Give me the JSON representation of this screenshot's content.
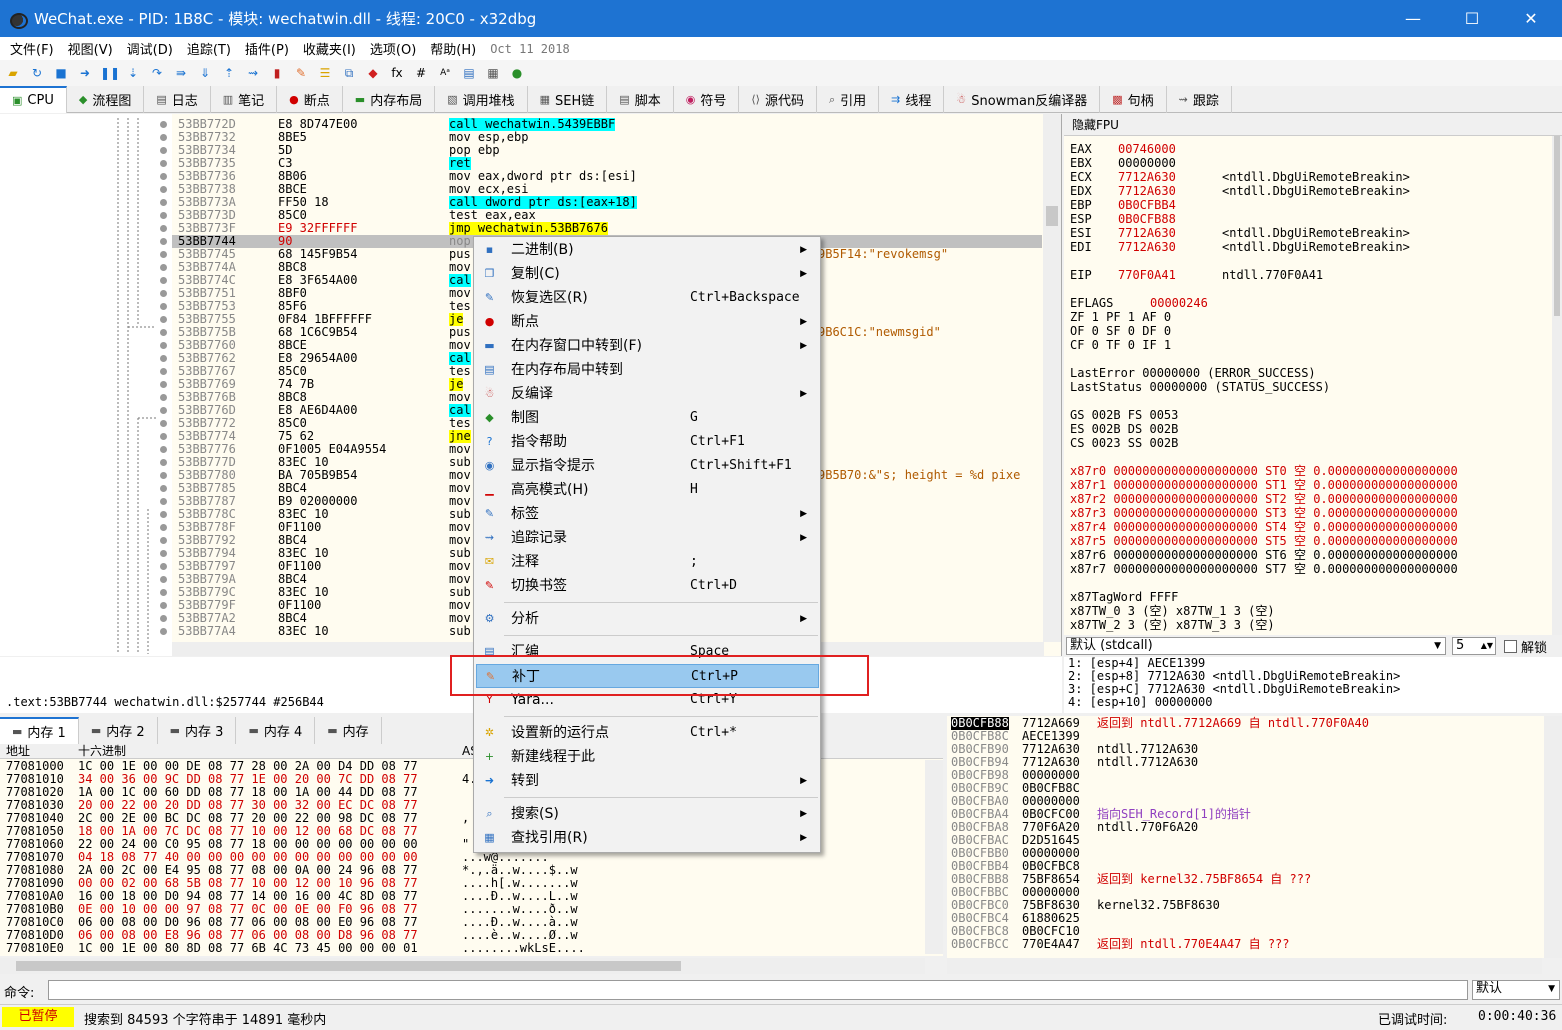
{
  "window": {
    "title": "WeChat.exe - PID: 1B8C - 模块: wechatwin.dll - 线程: 20C0 - x32dbg",
    "minimize": "—",
    "maximize": "☐",
    "close": "✕"
  },
  "menu": {
    "items": [
      "文件(F)",
      "视图(V)",
      "调试(D)",
      "追踪(T)",
      "插件(P)",
      "收藏夹(I)",
      "选项(O)",
      "帮助(H)"
    ],
    "date": "Oct 11 2018"
  },
  "tabs": [
    {
      "label": "CPU",
      "icon": "cpu-icon"
    },
    {
      "label": "流程图",
      "icon": "graph-icon"
    },
    {
      "label": "日志",
      "icon": "log-icon"
    },
    {
      "label": "笔记",
      "icon": "notes-icon"
    },
    {
      "label": "断点",
      "icon": "breakpoint-icon"
    },
    {
      "label": "内存布局",
      "icon": "memory-map-icon"
    },
    {
      "label": "调用堆栈",
      "icon": "call-stack-icon"
    },
    {
      "label": "SEH链",
      "icon": "seh-icon"
    },
    {
      "label": "脚本",
      "icon": "script-icon"
    },
    {
      "label": "符号",
      "icon": "symbol-icon"
    },
    {
      "label": "源代码",
      "icon": "source-icon"
    },
    {
      "label": "引用",
      "icon": "references-icon"
    },
    {
      "label": "线程",
      "icon": "threads-icon"
    },
    {
      "label": "Snowman反编译器",
      "icon": "snowman-icon"
    },
    {
      "label": "句柄",
      "icon": "handles-icon"
    },
    {
      "label": "跟踪",
      "icon": "trace-icon"
    }
  ],
  "disasm": [
    {
      "a": "53BB772D",
      "b": "E8 8D747E00",
      "m": "call wechatwin.5439EBBF",
      "t": "call"
    },
    {
      "a": "53BB7732",
      "b": "8BE5",
      "m": "mov esp,ebp"
    },
    {
      "a": "53BB7734",
      "b": "5D",
      "m": "pop ebp"
    },
    {
      "a": "53BB7735",
      "b": "C3",
      "m": "ret",
      "t": "ret"
    },
    {
      "a": "53BB7736",
      "b": "8B06",
      "m": "mov eax,dword ptr ds:[esi]"
    },
    {
      "a": "53BB7738",
      "b": "8BCE",
      "m": "mov ecx,esi"
    },
    {
      "a": "53BB773A",
      "b": "FF50 18",
      "m": "call dword ptr ds:[eax+18]",
      "t": "call"
    },
    {
      "a": "53BB773D",
      "b": "85C0",
      "m": "test eax,eax"
    },
    {
      "a": "53BB773F",
      "b": "E9 32FFFFFF",
      "m": "jmp wechatwin.53BB7676",
      "t": "jmp",
      "red": true
    },
    {
      "a": "53BB7744",
      "b": "90",
      "m": "nop",
      "sel": true,
      "red": true
    },
    {
      "a": "53BB7745",
      "b": "68 145F9B54",
      "m": "pus",
      "c": "9B5F14:\"revokemsg\""
    },
    {
      "a": "53BB774A",
      "b": "8BC8",
      "m": "mov"
    },
    {
      "a": "53BB774C",
      "b": "E8 3F654A00",
      "m": "cal",
      "t": "call"
    },
    {
      "a": "53BB7751",
      "b": "8BF0",
      "m": "mov"
    },
    {
      "a": "53BB7753",
      "b": "85F6",
      "m": "tes"
    },
    {
      "a": "53BB7755",
      "b": "0F84 1BFFFFFF",
      "m": "je",
      "t": "jmp"
    },
    {
      "a": "53BB775B",
      "b": "68 1C6C9B54",
      "m": "pus",
      "c": "9B6C1C:\"newmsgid\""
    },
    {
      "a": "53BB7760",
      "b": "8BCE",
      "m": "mov"
    },
    {
      "a": "53BB7762",
      "b": "E8 29654A00",
      "m": "cal",
      "t": "call"
    },
    {
      "a": "53BB7767",
      "b": "85C0",
      "m": "tes"
    },
    {
      "a": "53BB7769",
      "b": "74 7B",
      "m": "je",
      "t": "jmp"
    },
    {
      "a": "53BB776B",
      "b": "8BC8",
      "m": "mov"
    },
    {
      "a": "53BB776D",
      "b": "E8 AE6D4A00",
      "m": "cal",
      "t": "call"
    },
    {
      "a": "53BB7772",
      "b": "85C0",
      "m": "tes"
    },
    {
      "a": "53BB7774",
      "b": "75 62",
      "m": "jne",
      "t": "jmp"
    },
    {
      "a": "53BB7776",
      "b": "0F1005 E04A9554",
      "m": "mov"
    },
    {
      "a": "53BB777D",
      "b": "83EC 10",
      "m": "sub"
    },
    {
      "a": "53BB7780",
      "b": "BA 705B9B54",
      "m": "mov",
      "c": "9B5B70:&\"s; height = %d pixe"
    },
    {
      "a": "53BB7785",
      "b": "8BC4",
      "m": "mov"
    },
    {
      "a": "53BB7787",
      "b": "B9 02000000",
      "m": "mov"
    },
    {
      "a": "53BB778C",
      "b": "83EC 10",
      "m": "sub"
    },
    {
      "a": "53BB778F",
      "b": "0F1100",
      "m": "mov"
    },
    {
      "a": "53BB7792",
      "b": "8BC4",
      "m": "mov"
    },
    {
      "a": "53BB7794",
      "b": "83EC 10",
      "m": "sub"
    },
    {
      "a": "53BB7797",
      "b": "0F1100",
      "m": "mov"
    },
    {
      "a": "53BB779A",
      "b": "8BC4",
      "m": "mov"
    },
    {
      "a": "53BB779C",
      "b": "83EC 10",
      "m": "sub"
    },
    {
      "a": "53BB779F",
      "b": "0F1100",
      "m": "mov"
    },
    {
      "a": "53BB77A2",
      "b": "8BC4",
      "m": "mov"
    },
    {
      "a": "53BB77A4",
      "b": "83EC 10",
      "m": "sub"
    }
  ],
  "regs": {
    "header": "隐藏FPU",
    "lines": [
      [
        "EAX",
        "00746000",
        ""
      ],
      [
        "EBX",
        "00000000",
        ""
      ],
      [
        "ECX",
        "7712A630",
        "<ntdll.DbgUiRemoteBreakin>"
      ],
      [
        "EDX",
        "7712A630",
        "<ntdll.DbgUiRemoteBreakin>"
      ],
      [
        "EBP",
        "0B0CFBB4",
        ""
      ],
      [
        "ESP",
        "0B0CFB88",
        ""
      ],
      [
        "ESI",
        "7712A630",
        "<ntdll.DbgUiRemoteBreakin>"
      ],
      [
        "EDI",
        "7712A630",
        "<ntdll.DbgUiRemoteBreakin>"
      ]
    ],
    "eip": [
      "EIP",
      "770F0A41",
      "ntdll.770F0A41"
    ],
    "eflags": [
      "EFLAGS",
      "00000246"
    ],
    "flags": [
      "ZF 1  PF 1  AF 0",
      "OF 0  SF 0  DF 0",
      "CF 0  TF 0  IF 1"
    ],
    "lasterror": [
      "LastError  00000000 (ERROR_SUCCESS)",
      "LastStatus 00000000 (STATUS_SUCCESS)"
    ],
    "seg": [
      "GS 002B  FS 0053",
      "ES 002B  DS 002B",
      "CS 0023  SS 002B"
    ],
    "x87": [
      "x87r0 00000000000000000000 ST0 空 0.000000000000000000",
      "x87r1 00000000000000000000 ST1 空 0.000000000000000000",
      "x87r2 00000000000000000000 ST2 空 0.000000000000000000",
      "x87r3 00000000000000000000 ST3 空 0.000000000000000000",
      "x87r4 00000000000000000000 ST4 空 0.000000000000000000",
      "x87r5 00000000000000000000 ST5 空 0.000000000000000000",
      "x87r6 00000000000000000000 ST6 空 0.000000000000000000",
      "x87r7 00000000000000000000 ST7 空 0.000000000000000000"
    ],
    "tag": [
      "x87TagWord FFFF",
      "x87TW_0 3 (空)      x87TW_1 3 (空)",
      "x87TW_2 3 (空)      x87TW_3 3 (空)"
    ]
  },
  "callconv": {
    "value": "默认 (stdcall)",
    "count": "5",
    "unlock": "解锁"
  },
  "args": [
    "1: [esp+4] AECE1399",
    "2: [esp+8] 7712A630 <ntdll.DbgUiRemoteBreakin>",
    "3: [esp+C] 7712A630 <ntdll.DbgUiRemoteBreakin>",
    "4: [esp+10] 00000000"
  ],
  "info": ".text:53BB7744 wechatwin.dll:$257744 #256B44",
  "dumptabs": [
    "内存 1",
    "内存 2",
    "内存 3",
    "内存 4",
    "内存"
  ],
  "dump": {
    "h_addr": "地址",
    "h_hex": "十六进制",
    "h_ascii": "AS",
    "rows": [
      [
        "77081000",
        "1C 00 1E 00 00 DE 08 77 28 00 2A 00 D4 DD 08 77",
        ""
      ],
      [
        "77081010",
        "34 00 36 00 9C DD 08 77 1E 00 20 00 7C DD 08 77",
        "4."
      ],
      [
        "77081020",
        "1A 00 1C 00 60 DD 08 77 18 00 1A 00 44 DD 08 77",
        ""
      ],
      [
        "77081030",
        "20 00 22 00 20 DD 08 77 30 00 32 00 EC DC 08 77",
        ""
      ],
      [
        "77081040",
        "2C 00 2E 00 BC DC 08 77 20 00 22 00 98 DC 08 77",
        ","
      ],
      [
        "77081050",
        "18 00 1A 00 7C DC 08 77 10 00 12 00 68 DC 08 77",
        ""
      ],
      [
        "77081060",
        "22 00 24 00 C0 95 08 77 18 00 00 00 00 00 00 00",
        "\""
      ],
      [
        "77081070",
        "04 18 08 77 40 00 00 00 00 00 00 00 00 00 00 00",
        "...w@......."
      ],
      [
        "77081080",
        "2A 00 2C 00 E4 95 08 77 08 00 0A 00 24 96 08 77",
        "*.,.ä..w....$..w"
      ],
      [
        "77081090",
        "00 00 02 00 68 5B 08 77 10 00 12 00 10 96 08 77",
        "....h[.w.......w"
      ],
      [
        "770810A0",
        "16 00 18 00 D0 94 08 77 14 00 16 00 4C 8D 08 77",
        "....Ð..w....L..w"
      ],
      [
        "770810B0",
        "0E 00 10 00 00 97 08 77 0C 00 0E 00 F0 96 08 77",
        ".......w....ð..w"
      ],
      [
        "770810C0",
        "06 00 08 00 D0 96 08 77 06 00 08 00 E0 96 08 77",
        "....Ð..w....à..w"
      ],
      [
        "770810D0",
        "06 00 08 00 E8 96 08 77 06 00 08 00 D8 96 08 77",
        "....è..w....Ø..w"
      ],
      [
        "770810E0",
        "1C 00 1E 00 80 8D 08 77 6B 4C 73 45 00 00 00 01",
        "........wkLsE...."
      ]
    ]
  },
  "stack": [
    [
      "0B0CFB88",
      "7712A669",
      "返回到 ntdll.7712A669 自 ntdll.770F0A40",
      "r"
    ],
    [
      "0B0CFB8C",
      "AECE1399",
      "",
      ""
    ],
    [
      "0B0CFB90",
      "7712A630",
      "ntdll.7712A630",
      ""
    ],
    [
      "0B0CFB94",
      "7712A630",
      "ntdll.7712A630",
      ""
    ],
    [
      "0B0CFB98",
      "00000000",
      "",
      ""
    ],
    [
      "0B0CFB9C",
      "0B0CFB8C",
      "",
      ""
    ],
    [
      "0B0CFBA0",
      "00000000",
      "",
      ""
    ],
    [
      "0B0CFBA4",
      "0B0CFC00",
      "指向SEH_Record[1]的指针",
      "p"
    ],
    [
      "0B0CFBA8",
      "770F6A20",
      "ntdll.770F6A20",
      ""
    ],
    [
      "0B0CFBAC",
      "D2D51645",
      "",
      ""
    ],
    [
      "0B0CFBB0",
      "00000000",
      "",
      ""
    ],
    [
      "0B0CFBB4",
      "0B0CFBC8",
      "",
      ""
    ],
    [
      "0B0CFBB8",
      "75BF8654",
      "返回到 kernel32.75BF8654 自 ???",
      "r"
    ],
    [
      "0B0CFBBC",
      "00000000",
      "",
      ""
    ],
    [
      "0B0CFBC0",
      "75BF8630",
      "kernel32.75BF8630",
      ""
    ],
    [
      "0B0CFBC4",
      "61880625",
      "",
      ""
    ],
    [
      "0B0CFBC8",
      "0B0CFC10",
      "",
      ""
    ],
    [
      "0B0CFBCC",
      "770E4A47",
      "返回到 ntdll.770E4A47 自 ???",
      "r"
    ]
  ],
  "cmd": {
    "label": "命令:",
    "value": "",
    "mode": "默认"
  },
  "status": {
    "state": "已暂停",
    "msg": "搜索到 84593 个字符串于 14891 毫秒内",
    "time_label": "已调试时间:",
    "time": "0:00:40:36"
  },
  "ctx": [
    {
      "icon": "binary-icon",
      "label": "二进制(B)",
      "sc": "",
      "sub": true
    },
    {
      "icon": "copy-icon",
      "label": "复制(C)",
      "sc": "",
      "sub": true
    },
    {
      "icon": "restore-icon",
      "label": "恢复选区(R)",
      "sc": "Ctrl+Backspace"
    },
    {
      "icon": "breakpoint-icon",
      "label": "断点",
      "sc": "",
      "sub": true
    },
    {
      "icon": "memory-goto-icon",
      "label": "在内存窗口中转到(F)",
      "sc": "",
      "sub": true
    },
    {
      "icon": "memory-layout-icon",
      "label": "在内存布局中转到",
      "sc": ""
    },
    {
      "icon": "decompile-icon",
      "label": "反编译",
      "sc": "",
      "sub": true
    },
    {
      "icon": "graph-icon",
      "label": "制图",
      "sc": "G"
    },
    {
      "icon": "help-icon",
      "label": "指令帮助",
      "sc": "Ctrl+F1"
    },
    {
      "icon": "hint-icon",
      "label": "显示指令提示",
      "sc": "Ctrl+Shift+F1"
    },
    {
      "icon": "highlight-icon",
      "label": "高亮模式(H)",
      "sc": "H"
    },
    {
      "icon": "label-icon",
      "label": "标签",
      "sc": "",
      "sub": true
    },
    {
      "icon": "trace-record-icon",
      "label": "追踪记录",
      "sc": "",
      "sub": true
    },
    {
      "icon": "comment-icon",
      "label": "注释",
      "sc": ";"
    },
    {
      "icon": "bookmark-icon",
      "label": "切换书签",
      "sc": "Ctrl+D"
    },
    {
      "icon": "analyze-icon",
      "label": "分析",
      "sc": "",
      "sub": true
    },
    {
      "icon": "assemble-icon",
      "label": "汇编",
      "sc": "Space"
    },
    {
      "icon": "patch-icon",
      "label": "补丁",
      "sc": "Ctrl+P",
      "hl": true
    },
    {
      "icon": "yara-icon",
      "label": "Yara...",
      "sc": "Ctrl+Y"
    },
    {
      "icon": "new-origin-icon",
      "label": "设置新的运行点",
      "sc": "Ctrl+*"
    },
    {
      "icon": "new-thread-icon",
      "label": "新建线程于此",
      "sc": ""
    },
    {
      "icon": "goto-icon",
      "label": "转到",
      "sc": "",
      "sub": true
    },
    {
      "icon": "search-icon",
      "label": "搜索(S)",
      "sc": "",
      "sub": true
    },
    {
      "icon": "find-ref-icon",
      "label": "查找引用(R)",
      "sc": "",
      "sub": true
    }
  ],
  "colors": {
    "titlebar": "#1e73d2",
    "accent_red": "#d00000",
    "highlight": "#99c9ef"
  }
}
